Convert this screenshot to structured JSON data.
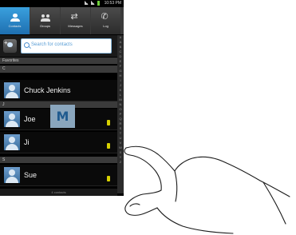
{
  "status_bar": {
    "time": "10:53 PM",
    "icons": [
      "signal-icon",
      "signal-icon",
      "battery-icon"
    ]
  },
  "tabs": [
    {
      "label": "Contacts",
      "icon": "person-icon",
      "active": true
    },
    {
      "label": "Groups",
      "icon": "group-icon",
      "active": false
    },
    {
      "label": "Messages",
      "icon": "arrows-icon",
      "active": false
    },
    {
      "label": "Log",
      "icon": "call-log-icon",
      "active": false
    }
  ],
  "search": {
    "placeholder": "Search for contacts"
  },
  "list": {
    "section_favorites": "Favorites",
    "section_c": "C",
    "section_j": "J",
    "section_s": "S",
    "contacts": [
      {
        "name": "Chuck Jenkins"
      },
      {
        "name": "Joe"
      },
      {
        "name": "Ji"
      },
      {
        "name": "Sue"
      }
    ]
  },
  "index_letters": [
    "#",
    "A",
    "B",
    "C",
    "D",
    "E",
    "F",
    "G",
    "H",
    "I",
    "J",
    "K",
    "L",
    "M",
    "N",
    "O",
    "P",
    "Q",
    "R",
    "S",
    "T",
    "U",
    "V",
    "W",
    "X",
    "Y",
    "Z"
  ],
  "popup_letter": "M",
  "footer": "4 contacts",
  "colors": {
    "active_tab": "#2a86c9",
    "presence": "#d7d100",
    "popup": "#8aa6bd"
  }
}
